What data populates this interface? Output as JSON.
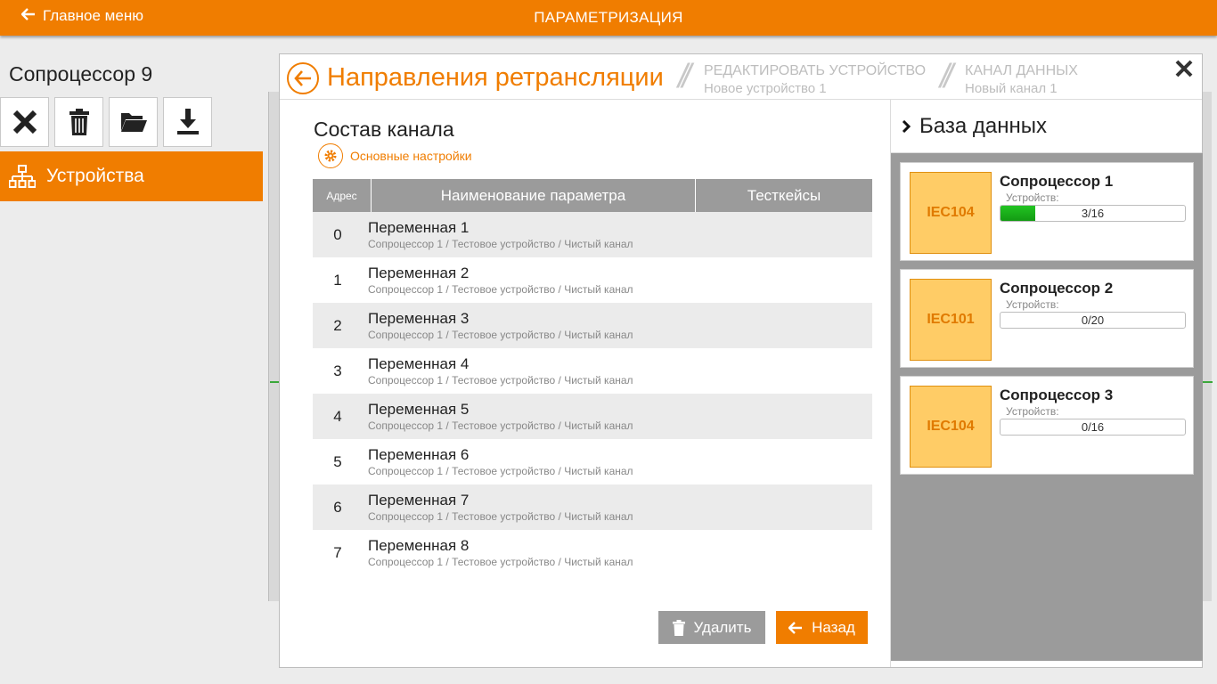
{
  "topbar": {
    "back_label": "Главное меню",
    "title": "ПАРАМЕТРИЗАЦИЯ"
  },
  "left": {
    "title": "Сопроцессор 9",
    "toolbar": [
      "close-icon",
      "trash-icon",
      "folder-open-icon",
      "download-icon"
    ],
    "nav_item": "Устройства"
  },
  "modal": {
    "title": "Направления ретрансляции",
    "crumbs": [
      {
        "line1": "РЕДАКТИРОВАТЬ УСТРОЙСТВО",
        "line2": "Новое устройство 1"
      },
      {
        "line1": "КАНАЛ ДАННЫХ",
        "line2": "Новый канал 1"
      }
    ],
    "crumb_sep": "//"
  },
  "channel": {
    "title": "Состав канала",
    "settings_link": "Основные настройки",
    "headers": {
      "addr": "Адрес",
      "name": "Наименование параметра",
      "test": "Тесткейсы"
    },
    "rows": [
      {
        "addr": "0",
        "name": "Переменная 1",
        "path": "Сопроцессор 1 / Тестовое устройство / Чистый канал"
      },
      {
        "addr": "1",
        "name": "Переменная 2",
        "path": "Сопроцессор 1 / Тестовое устройство / Чистый канал"
      },
      {
        "addr": "2",
        "name": "Переменная 3",
        "path": "Сопроцессор 1 / Тестовое устройство / Чистый канал"
      },
      {
        "addr": "3",
        "name": "Переменная 4",
        "path": "Сопроцессор 1 / Тестовое устройство / Чистый канал"
      },
      {
        "addr": "4",
        "name": "Переменная 5",
        "path": "Сопроцессор 1 / Тестовое устройство / Чистый канал"
      },
      {
        "addr": "5",
        "name": "Переменная 6",
        "path": "Сопроцессор 1 / Тестовое устройство / Чистый канал"
      },
      {
        "addr": "6",
        "name": "Переменная 7",
        "path": "Сопроцессор 1 / Тестовое устройство / Чистый канал"
      },
      {
        "addr": "7",
        "name": "Переменная 8",
        "path": "Сопроцессор 1 / Тестовое устройство / Чистый канал"
      }
    ],
    "delete_label": "Удалить",
    "back_label": "Назад"
  },
  "database": {
    "title": "База данных",
    "cards": [
      {
        "name": "Сопроцессор 1",
        "protocol": "IEC104",
        "sub": "Устройств:",
        "progress": "3/16",
        "fraction": 0.1875
      },
      {
        "name": "Сопроцессор 2",
        "protocol": "IEC101",
        "sub": "Устройств:",
        "progress": "0/20",
        "fraction": 0
      },
      {
        "name": "Сопроцессор 3",
        "protocol": "IEC104",
        "sub": "Устройств:",
        "progress": "0/16",
        "fraction": 0
      }
    ]
  },
  "colors": {
    "accent": "#f07d00",
    "header_gray": "#9b9b9b",
    "badge": "#ffcc66",
    "progress": "#22c422"
  }
}
